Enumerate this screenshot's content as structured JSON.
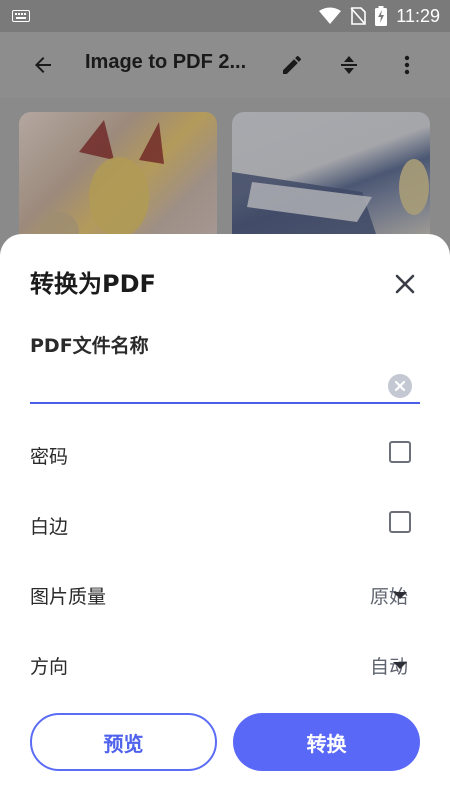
{
  "status_bar": {
    "time": "11:29",
    "icons": [
      "keyboard-icon",
      "wifi-icon",
      "no-sim-icon",
      "battery-charging-icon"
    ]
  },
  "app_bar": {
    "title": "Image to PDF 2...",
    "icons": [
      "back-arrow-icon",
      "edit-pencil-icon",
      "sort-icon",
      "more-vert-icon"
    ]
  },
  "sheet": {
    "title": "转换为PDF",
    "file_name_label": "PDF文件名称",
    "file_name_value": "",
    "rows": {
      "password": {
        "label": "密码",
        "checked": false
      },
      "white_border": {
        "label": "白边",
        "checked": false
      },
      "image_quality": {
        "label": "图片质量",
        "value": "原始"
      },
      "orientation": {
        "label": "方向",
        "value": "自动"
      }
    },
    "buttons": {
      "preview": "预览",
      "convert": "转换"
    }
  },
  "colors": {
    "accent": "#5a68f7",
    "scrim": "#8a8a8a",
    "sheet_bg": "#ffffff"
  }
}
